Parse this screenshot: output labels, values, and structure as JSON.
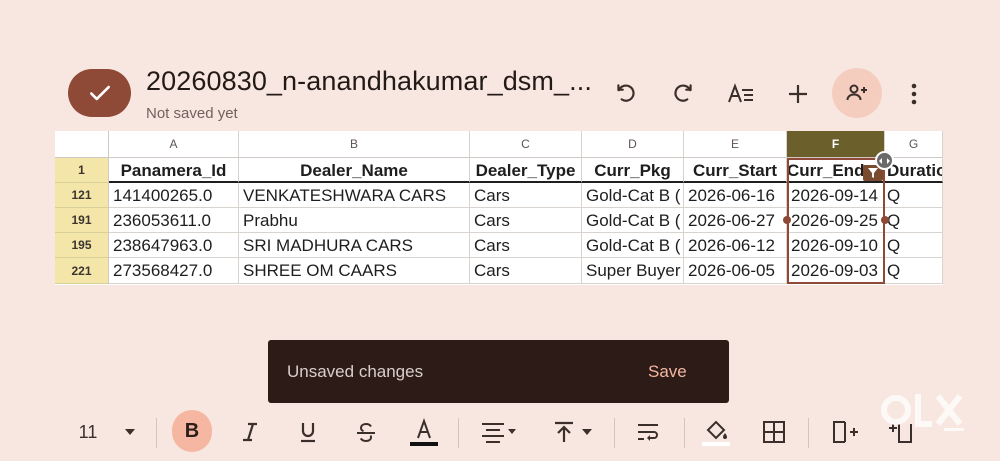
{
  "header": {
    "title": "20260830_n-anandhakumar_dsm_...",
    "status": "Not saved yet"
  },
  "columns": [
    "A",
    "B",
    "C",
    "D",
    "E",
    "F",
    "G"
  ],
  "header_row": {
    "row_number": "1",
    "cells": [
      "Panamera_Id",
      "Dealer_Name",
      "Dealer_Type",
      "Curr_Pkg",
      "Curr_Start",
      "Curr_End",
      "Duratio"
    ]
  },
  "rows": [
    {
      "row_number": "121",
      "cells": [
        "141400265.0",
        "VENKATESHWARA CARS",
        "Cars",
        "Gold-Cat B (",
        "2026-06-16",
        "2026-09-14",
        "Q"
      ]
    },
    {
      "row_number": "191",
      "cells": [
        "236053611.0",
        "Prabhu",
        "Cars",
        "Gold-Cat B (",
        "2026-06-27",
        "2026-09-25",
        "Q"
      ]
    },
    {
      "row_number": "195",
      "cells": [
        "238647963.0",
        "SRI MADHURA CARS",
        "Cars",
        "Gold-Cat B (",
        "2026-06-12",
        "2026-09-10",
        "Q"
      ]
    },
    {
      "row_number": "221",
      "cells": [
        "273568427.0",
        "SHREE OM CAARS",
        "Cars",
        "Super Buyer",
        "2026-06-05",
        "2026-09-03",
        "Q"
      ]
    }
  ],
  "selected_column": "F",
  "snackbar": {
    "message": "Unsaved changes",
    "action": "Save"
  },
  "toolbar": {
    "font_size": "11",
    "bold_label": "B"
  },
  "colors": {
    "accent": "#8e4a36",
    "background": "#f8e7e1",
    "row_header": "#f3e6a8"
  }
}
